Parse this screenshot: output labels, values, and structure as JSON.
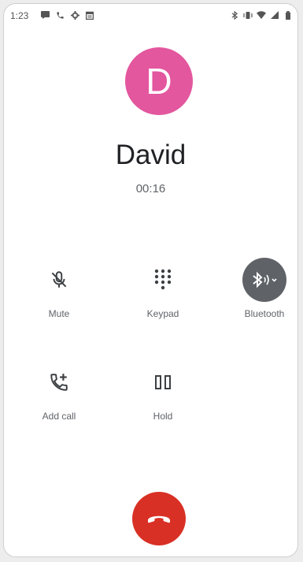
{
  "status_bar": {
    "time": "1:23",
    "left_icons": [
      "message-icon",
      "phone-icon",
      "settings-icon",
      "calendar-icon"
    ],
    "right_icons": [
      "bluetooth-icon",
      "vibrate-icon",
      "wifi-icon",
      "signal-icon",
      "battery-icon"
    ]
  },
  "contact": {
    "initial": "D",
    "name": "David",
    "avatar_color": "#e3579f"
  },
  "call": {
    "timer": "00:16"
  },
  "controls": {
    "mute_label": "Mute",
    "keypad_label": "Keypad",
    "bluetooth_label": "Bluetooth",
    "add_call_label": "Add call",
    "hold_label": "Hold"
  },
  "colors": {
    "end_call": "#d93025",
    "active_control": "#5f6368"
  }
}
